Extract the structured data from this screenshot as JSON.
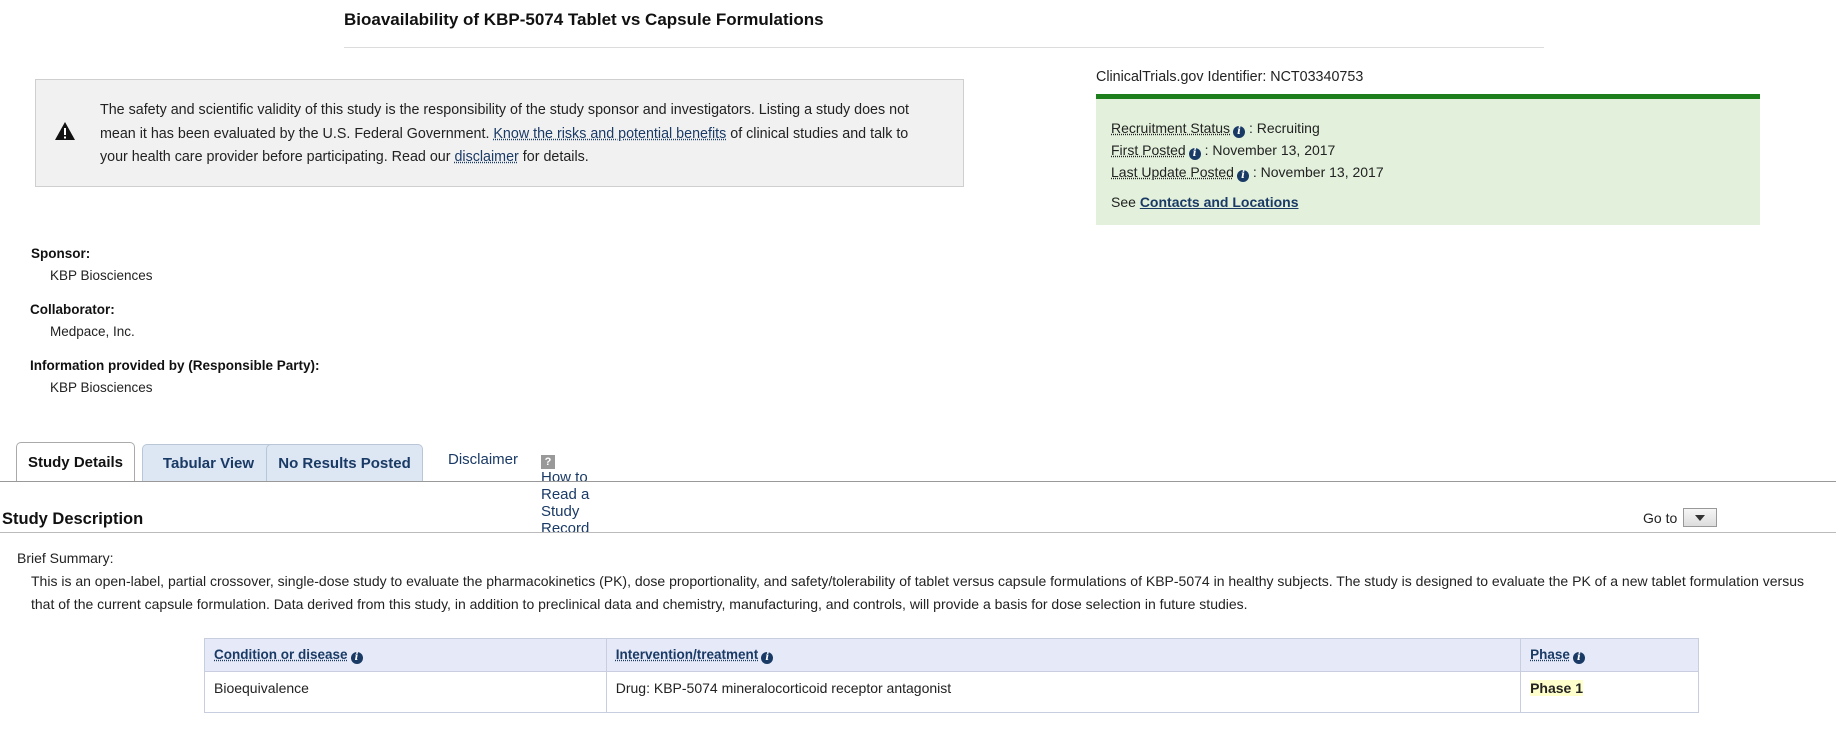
{
  "page": {
    "title": "Bioavailability of KBP-5074 Tablet vs Capsule Formulations"
  },
  "disclaimer_box": {
    "text_1": "The safety and scientific validity of this study is the responsibility of the study sponsor and investigators. Listing a study does not mean it has been evaluated by the U.S. Federal Government. ",
    "risks_link": "Know the risks and potential benefits",
    "text_2": " of clinical studies and talk to your health care provider before participating. Read our ",
    "disclaimer_link": "disclaimer",
    "text_3": " for details.",
    "icon": "warning-icon"
  },
  "status": {
    "identifier_label": "ClinicalTrials.gov Identifier: NCT03340753",
    "recruitment_label": "Recruitment Status",
    "recruitment_value": " : Recruiting",
    "first_posted_label": "First Posted",
    "first_posted_value": " : November 13, 2017",
    "last_update_label": "Last Update Posted",
    "last_update_value": " : November 13, 2017",
    "see_text": "See ",
    "contacts_link": "Contacts and Locations",
    "accent_color": "#1c7f1c",
    "box_color": "#e3f1dc"
  },
  "parties": {
    "sponsor_label": "Sponsor:",
    "sponsor_value": "KBP Biosciences",
    "collaborator_label": "Collaborator:",
    "collaborator_value": "Medpace, Inc.",
    "info_label": "Information provided by (Responsible Party):",
    "info_value": "KBP Biosciences"
  },
  "tabs": [
    {
      "label": "Study Details",
      "active": true
    },
    {
      "label": "Tabular View",
      "active": false
    },
    {
      "label": "No Results Posted",
      "active": false
    }
  ],
  "links": {
    "disclaimer": "Disclaimer",
    "how_to_read": "How to Read a Study Record",
    "help_icon": "?"
  },
  "study_description": {
    "title": "Study Description",
    "goto_label": "Go to",
    "brief_summary_label": "Brief Summary:",
    "brief_summary_text": "This is an open-label, partial crossover, single-dose study to evaluate the pharmacokinetics (PK), dose proportionality, and safety/tolerability of tablet versus capsule formulations of KBP-5074 in healthy subjects. The study is designed to evaluate the PK of a new tablet formulation versus that of the current capsule formulation. Data derived from this study, in addition to preclinical data and chemistry, manufacturing, and controls, will provide a basis for dose selection in future studies."
  },
  "conditions_table": {
    "headers": [
      "Condition or disease",
      "Intervention/treatment",
      "Phase"
    ],
    "rows": [
      [
        "Bioequivalence",
        "Drug: KBP-5074 mineralocorticoid receptor antagonist",
        "Phase 1"
      ]
    ]
  },
  "info_icon_glyph": "i"
}
